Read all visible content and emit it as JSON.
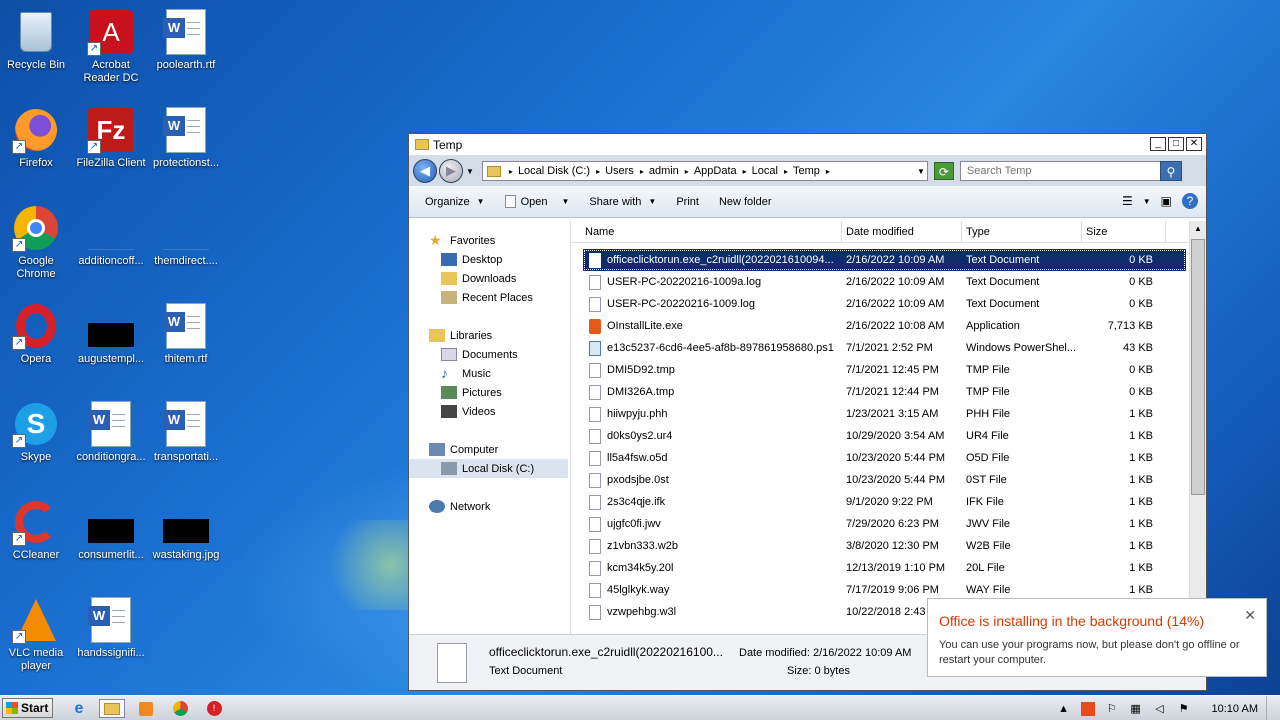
{
  "desktop": {
    "icons": [
      {
        "label": "Recycle Bin",
        "icon": "recycle-bin-icon"
      },
      {
        "label": "Acrobat Reader DC",
        "icon": "acrobat-icon"
      },
      {
        "label": "poolearth.rtf",
        "icon": "word-doc-icon"
      },
      {
        "label": "Firefox",
        "icon": "firefox-icon"
      },
      {
        "label": "FileZilla Client",
        "icon": "filezilla-icon"
      },
      {
        "label": "protectionst...",
        "icon": "word-doc-icon"
      },
      {
        "label": "Google Chrome",
        "icon": "chrome-icon"
      },
      {
        "label": "additioncoff...",
        "icon": "file-icon"
      },
      {
        "label": "themdirect....",
        "icon": "file-icon"
      },
      {
        "label": "Opera",
        "icon": "opera-icon"
      },
      {
        "label": "augustempl...",
        "icon": "file-icon"
      },
      {
        "label": "thitem.rtf",
        "icon": "word-doc-icon"
      },
      {
        "label": "Skype",
        "icon": "skype-icon"
      },
      {
        "label": "conditiongra...",
        "icon": "word-doc-icon"
      },
      {
        "label": "transportati...",
        "icon": "word-doc-icon"
      },
      {
        "label": "CCleaner",
        "icon": "ccleaner-icon"
      },
      {
        "label": "consumerlit...",
        "icon": "file-icon"
      },
      {
        "label": "wastaking.jpg",
        "icon": "image-icon"
      },
      {
        "label": "VLC media player",
        "icon": "vlc-icon"
      },
      {
        "label": "handssignifi...",
        "icon": "word-doc-icon"
      }
    ]
  },
  "window": {
    "title": "Temp",
    "controls": {
      "minimize": "_",
      "maximize": "□",
      "close": "✕"
    },
    "breadcrumbs": [
      "Local Disk (C:)",
      "Users",
      "admin",
      "AppData",
      "Local",
      "Temp"
    ],
    "search_placeholder": "Search Temp",
    "toolbar": {
      "organize": "Organize",
      "open": "Open",
      "share_with": "Share with",
      "print": "Print",
      "new_folder": "New folder"
    },
    "nav": {
      "favorites": "Favorites",
      "desktop": "Desktop",
      "downloads": "Downloads",
      "recent_places": "Recent Places",
      "libraries": "Libraries",
      "documents": "Documents",
      "music": "Music",
      "pictures": "Pictures",
      "videos": "Videos",
      "computer": "Computer",
      "local_disk": "Local Disk (C:)",
      "network": "Network"
    },
    "columns": {
      "name": "Name",
      "date": "Date modified",
      "type": "Type",
      "size": "Size"
    },
    "files": [
      {
        "name": "officeclicktorun.exe_c2ruidll(2022021610094...",
        "date": "2/16/2022 10:09 AM",
        "type": "Text Document",
        "size": "0 KB",
        "kind": "doc"
      },
      {
        "name": "USER-PC-20220216-1009a.log",
        "date": "2/16/2022 10:09 AM",
        "type": "Text Document",
        "size": "0 KB",
        "kind": "doc"
      },
      {
        "name": "USER-PC-20220216-1009.log",
        "date": "2/16/2022 10:09 AM",
        "type": "Text Document",
        "size": "0 KB",
        "kind": "doc"
      },
      {
        "name": "OInstallLite.exe",
        "date": "2/16/2022 10:08 AM",
        "type": "Application",
        "size": "7,713 KB",
        "kind": "app"
      },
      {
        "name": "e13c5237-6cd6-4ee5-af8b-897861958680.ps1",
        "date": "7/1/2021 2:52 PM",
        "type": "Windows PowerShel...",
        "size": "43 KB",
        "kind": "ps"
      },
      {
        "name": "DMI5D92.tmp",
        "date": "7/1/2021 12:45 PM",
        "type": "TMP File",
        "size": "0 KB",
        "kind": "doc"
      },
      {
        "name": "DMI326A.tmp",
        "date": "7/1/2021 12:44 PM",
        "type": "TMP File",
        "size": "0 KB",
        "kind": "doc"
      },
      {
        "name": "hiiwpyju.phh",
        "date": "1/23/2021 3:15 AM",
        "type": "PHH File",
        "size": "1 KB",
        "kind": "doc"
      },
      {
        "name": "d0ks0ys2.ur4",
        "date": "10/29/2020 3:54 AM",
        "type": "UR4 File",
        "size": "1 KB",
        "kind": "doc"
      },
      {
        "name": "ll5a4fsw.o5d",
        "date": "10/23/2020 5:44 PM",
        "type": "O5D File",
        "size": "1 KB",
        "kind": "doc"
      },
      {
        "name": "pxodsjbe.0st",
        "date": "10/23/2020 5:44 PM",
        "type": "0ST File",
        "size": "1 KB",
        "kind": "doc"
      },
      {
        "name": "2s3c4qje.ifk",
        "date": "9/1/2020 9:22 PM",
        "type": "IFK File",
        "size": "1 KB",
        "kind": "doc"
      },
      {
        "name": "ujgfc0fi.jwv",
        "date": "7/29/2020 6:23 PM",
        "type": "JWV File",
        "size": "1 KB",
        "kind": "doc"
      },
      {
        "name": "z1vbn333.w2b",
        "date": "3/8/2020 12:30 PM",
        "type": "W2B File",
        "size": "1 KB",
        "kind": "doc"
      },
      {
        "name": "kcm34k5y.20l",
        "date": "12/13/2019 1:10 PM",
        "type": "20L File",
        "size": "1 KB",
        "kind": "doc"
      },
      {
        "name": "45lglkyk.way",
        "date": "7/17/2019 9:06 PM",
        "type": "WAY File",
        "size": "1 KB",
        "kind": "doc"
      },
      {
        "name": "vzwpehbg.w3l",
        "date": "10/22/2018 2:43 ...",
        "type": "",
        "size": "",
        "kind": "doc"
      }
    ],
    "details": {
      "name": "officeclicktorun.exe_c2ruidll(20220216100...",
      "type": "Text Document",
      "modified": "Date modified: 2/16/2022 10:09 AM",
      "size": "Size: 0 bytes"
    }
  },
  "notification": {
    "title": "Office is installing in the background (14%)",
    "progress_percent": 14,
    "body": "You can use your programs now, but please don't go offline or restart your computer.",
    "close": "✕"
  },
  "taskbar": {
    "start_label": "Start",
    "clock": "10:10 AM"
  }
}
